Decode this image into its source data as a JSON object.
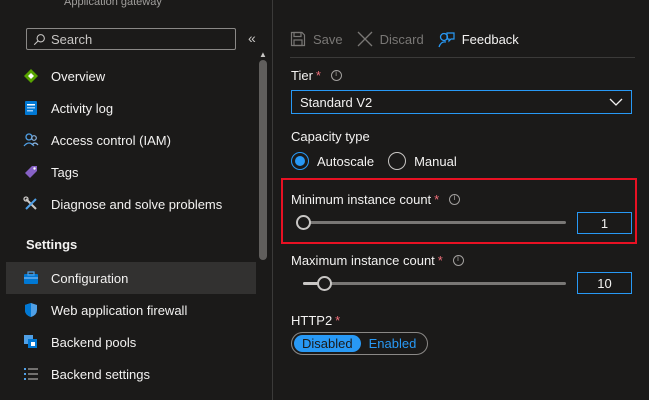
{
  "header": {
    "subtitle": "Application gateway"
  },
  "sidebar": {
    "search_placeholder": "Search",
    "collapse_label": "«",
    "items_top": [
      {
        "label": "Overview",
        "icon": "overview-icon"
      },
      {
        "label": "Activity log",
        "icon": "activity-log-icon"
      },
      {
        "label": "Access control (IAM)",
        "icon": "access-control-icon"
      },
      {
        "label": "Tags",
        "icon": "tag-icon"
      },
      {
        "label": "Diagnose and solve problems",
        "icon": "wrench-icon"
      }
    ],
    "settings_header": "Settings",
    "items_settings": [
      {
        "label": "Configuration",
        "icon": "configuration-icon",
        "active": true
      },
      {
        "label": "Web application firewall",
        "icon": "shield-icon"
      },
      {
        "label": "Backend pools",
        "icon": "backend-pools-icon"
      },
      {
        "label": "Backend settings",
        "icon": "list-settings-icon"
      }
    ]
  },
  "toolbar": {
    "save_label": "Save",
    "discard_label": "Discard",
    "feedback_label": "Feedback"
  },
  "form": {
    "tier": {
      "label": "Tier",
      "required_mark": "*",
      "value": "Standard V2"
    },
    "capacity": {
      "label": "Capacity type",
      "options": [
        "Autoscale",
        "Manual"
      ],
      "selected": "Autoscale"
    },
    "min_instance": {
      "label": "Minimum instance count",
      "required_mark": "*",
      "value": "1",
      "level": 0.0
    },
    "max_instance": {
      "label": "Maximum instance count",
      "required_mark": "*",
      "value": "10",
      "level": 0.04
    },
    "http2": {
      "label": "HTTP2",
      "required_mark": "*",
      "options": [
        "Disabled",
        "Enabled"
      ],
      "selected": "Disabled"
    }
  },
  "colors": {
    "accent": "#2899f5",
    "highlight_border": "#e81123",
    "required": "#f1707b",
    "background": "#1b1a19"
  }
}
